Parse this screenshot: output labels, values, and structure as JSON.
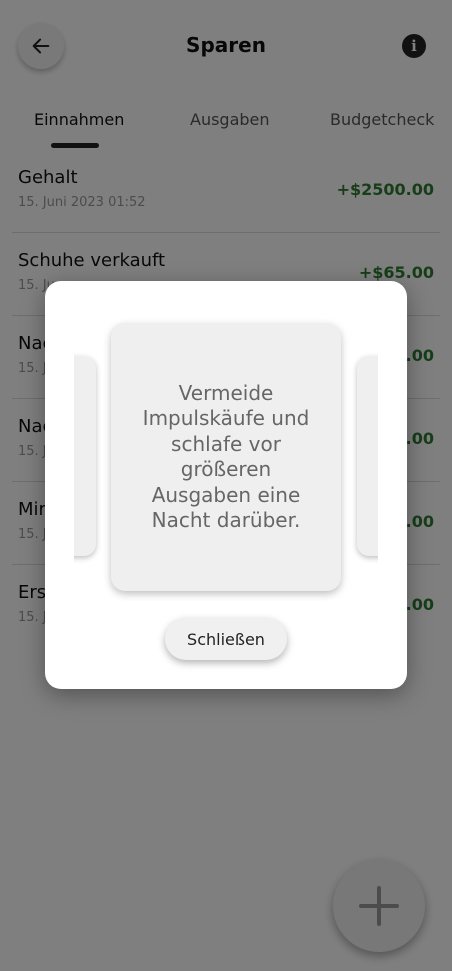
{
  "header": {
    "title": "Sparen",
    "back_icon": "arrow-left-icon",
    "info_icon": "info-icon",
    "info_glyph": "i"
  },
  "tabs": [
    {
      "label": "Einnahmen",
      "active": true
    },
    {
      "label": "Ausgaben",
      "active": false
    },
    {
      "label": "Budgetcheck",
      "active": false
    }
  ],
  "transactions": [
    {
      "title": "Gehalt",
      "date": "15. Juni 2023 01:52",
      "amount": "+$2500.00"
    },
    {
      "title": "Schuhe verkauft",
      "date": "15. Ju",
      "amount": "+$65.00"
    },
    {
      "title": "Nac",
      "date": "15. J",
      "amount": ".00"
    },
    {
      "title": "Nac",
      "date": "15. J",
      "amount": ".00"
    },
    {
      "title": "Mir",
      "date": "15. J",
      "amount": ".00"
    },
    {
      "title": "Ers",
      "date": "15. J",
      "amount": ".00"
    }
  ],
  "fab": {
    "icon": "plus-icon"
  },
  "dialog": {
    "tip": "Vermeide Impulskäufe und schlafe vor größeren Ausgaben eine Nacht darüber.",
    "close_label": "Schließen"
  },
  "colors": {
    "income_green": "#2e7d32",
    "scrim": "rgba(0,0,0,0.5)"
  }
}
